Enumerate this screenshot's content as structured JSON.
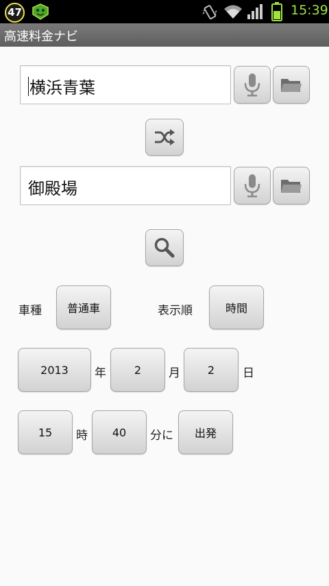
{
  "status_bar": {
    "notification_count": "47",
    "time": "15:39",
    "icons": [
      "app-icon",
      "vibrate-icon",
      "wifi-icon",
      "signal-icon",
      "battery-icon"
    ]
  },
  "app": {
    "title": "高速料金ナビ"
  },
  "route": {
    "from_value": "横浜青葉",
    "to_value": "御殿場"
  },
  "vehicle": {
    "label": "車種",
    "value": "普通車"
  },
  "sort": {
    "label": "表示順",
    "value": "時間"
  },
  "date": {
    "year": "2013",
    "year_unit": "年",
    "month": "2",
    "month_unit": "月",
    "day": "2",
    "day_unit": "日"
  },
  "time": {
    "hour": "15",
    "hour_unit": "時",
    "minute": "40",
    "minute_unit": "分に",
    "mode": "出発"
  },
  "colors": {
    "time_text": "#9ee342",
    "title_bar": "#6b6b6b",
    "background": "#fafafa"
  }
}
